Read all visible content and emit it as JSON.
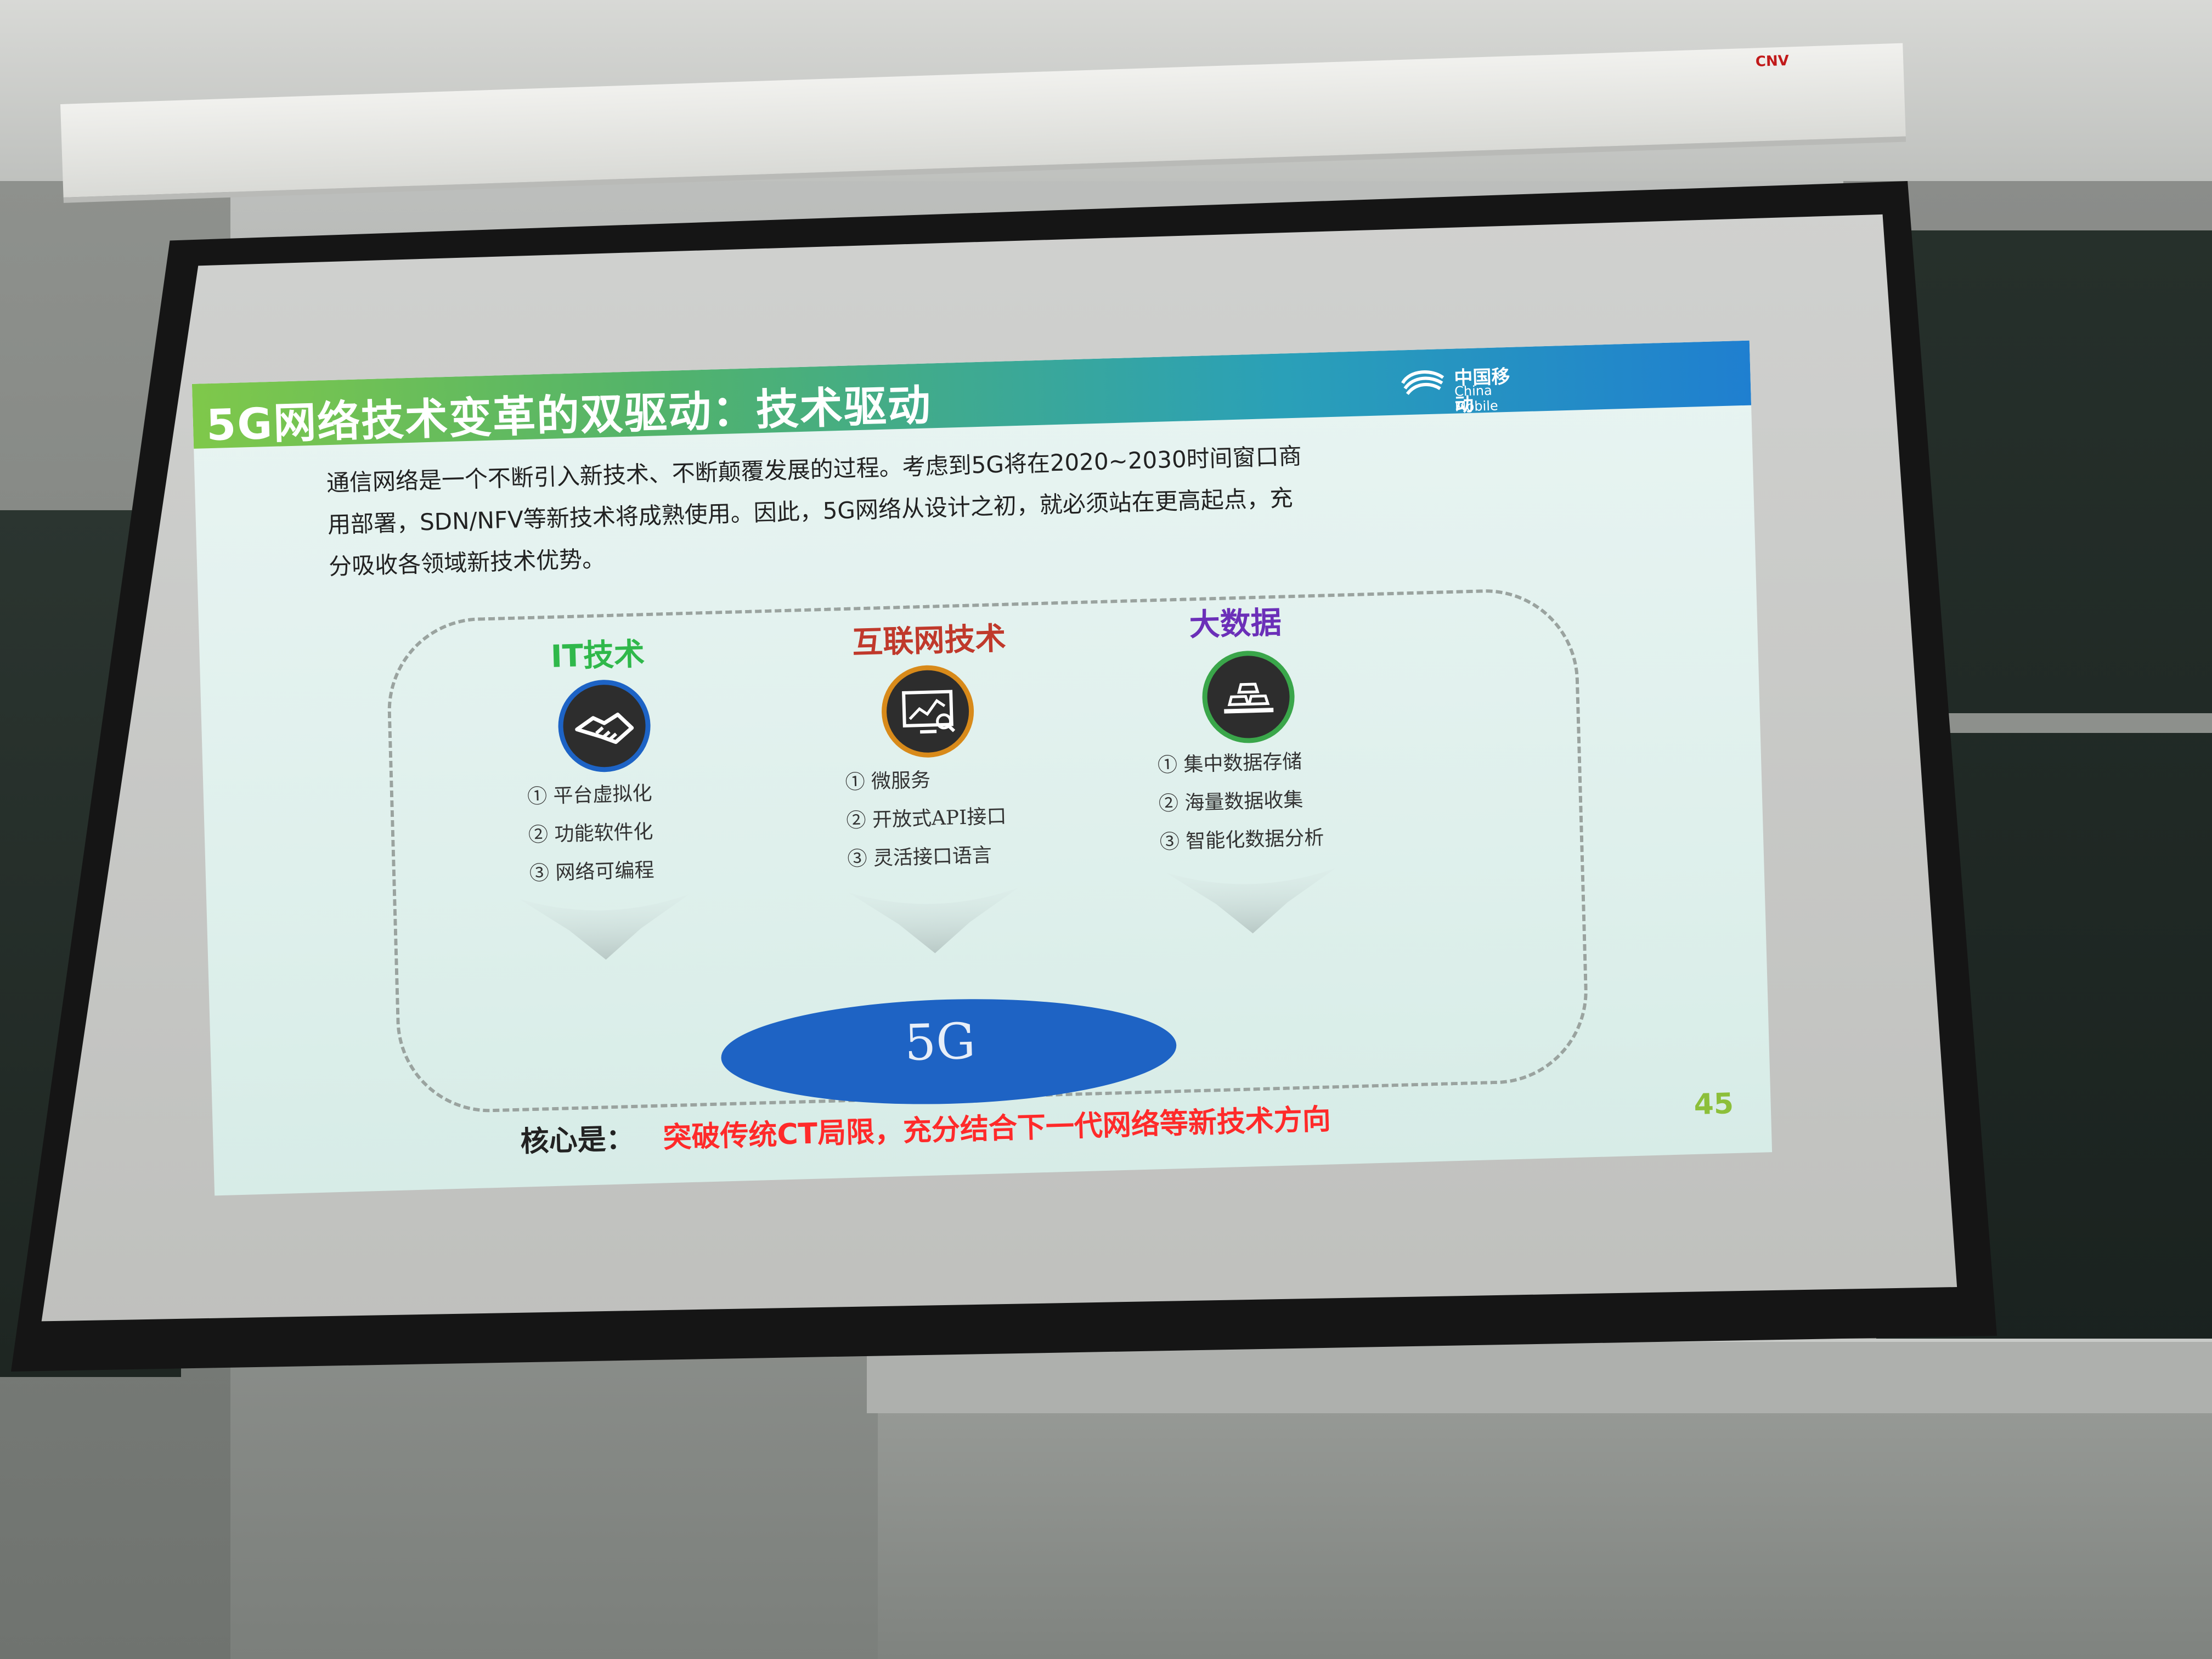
{
  "projector": {
    "brand": "CNV"
  },
  "slide": {
    "title": "5G网络技术变革的双驱动：技术驱动",
    "logo": {
      "cn": "中国移动",
      "en": "China Mobile"
    },
    "intro_lines": [
      "通信网络是一个不断引入新技术、不断颠覆发展的过程。考虑到5G将在2020~2030时间窗口商",
      "用部署，SDN/NFV等新技术将成熟使用。因此，5G网络从设计之初，就必须站在更高起点，充",
      "分吸收各领域新技术优势。"
    ],
    "columns": [
      {
        "title": "IT技术",
        "icon": "handshake-icon",
        "items": [
          "①  平台虚拟化",
          "②  功能软件化",
          "③  网络可编程"
        ]
      },
      {
        "title": "互联网技术",
        "icon": "monitor-chart-icon",
        "items": [
          "①  微服务",
          "②  开放式API接口",
          "③  灵活接口语言"
        ]
      },
      {
        "title": "大数据",
        "icon": "data-stack-icon",
        "items": [
          "①  集中数据存储",
          "②  海量数据收集",
          "③  智能化数据分析"
        ]
      }
    ],
    "center_label": "5G",
    "core_prefix": "核心是：",
    "core_text": "突破传统CT局限，充分结合下一代网络等新技术方向",
    "page_number": "45"
  },
  "colors": {
    "col1_title": "#2fb84a",
    "col2_title": "#c0392b",
    "col3_title": "#6b2fb8",
    "col1_ring": "#1d63c5",
    "col2_ring": "#d88a1a",
    "col3_ring": "#3aa64a"
  }
}
